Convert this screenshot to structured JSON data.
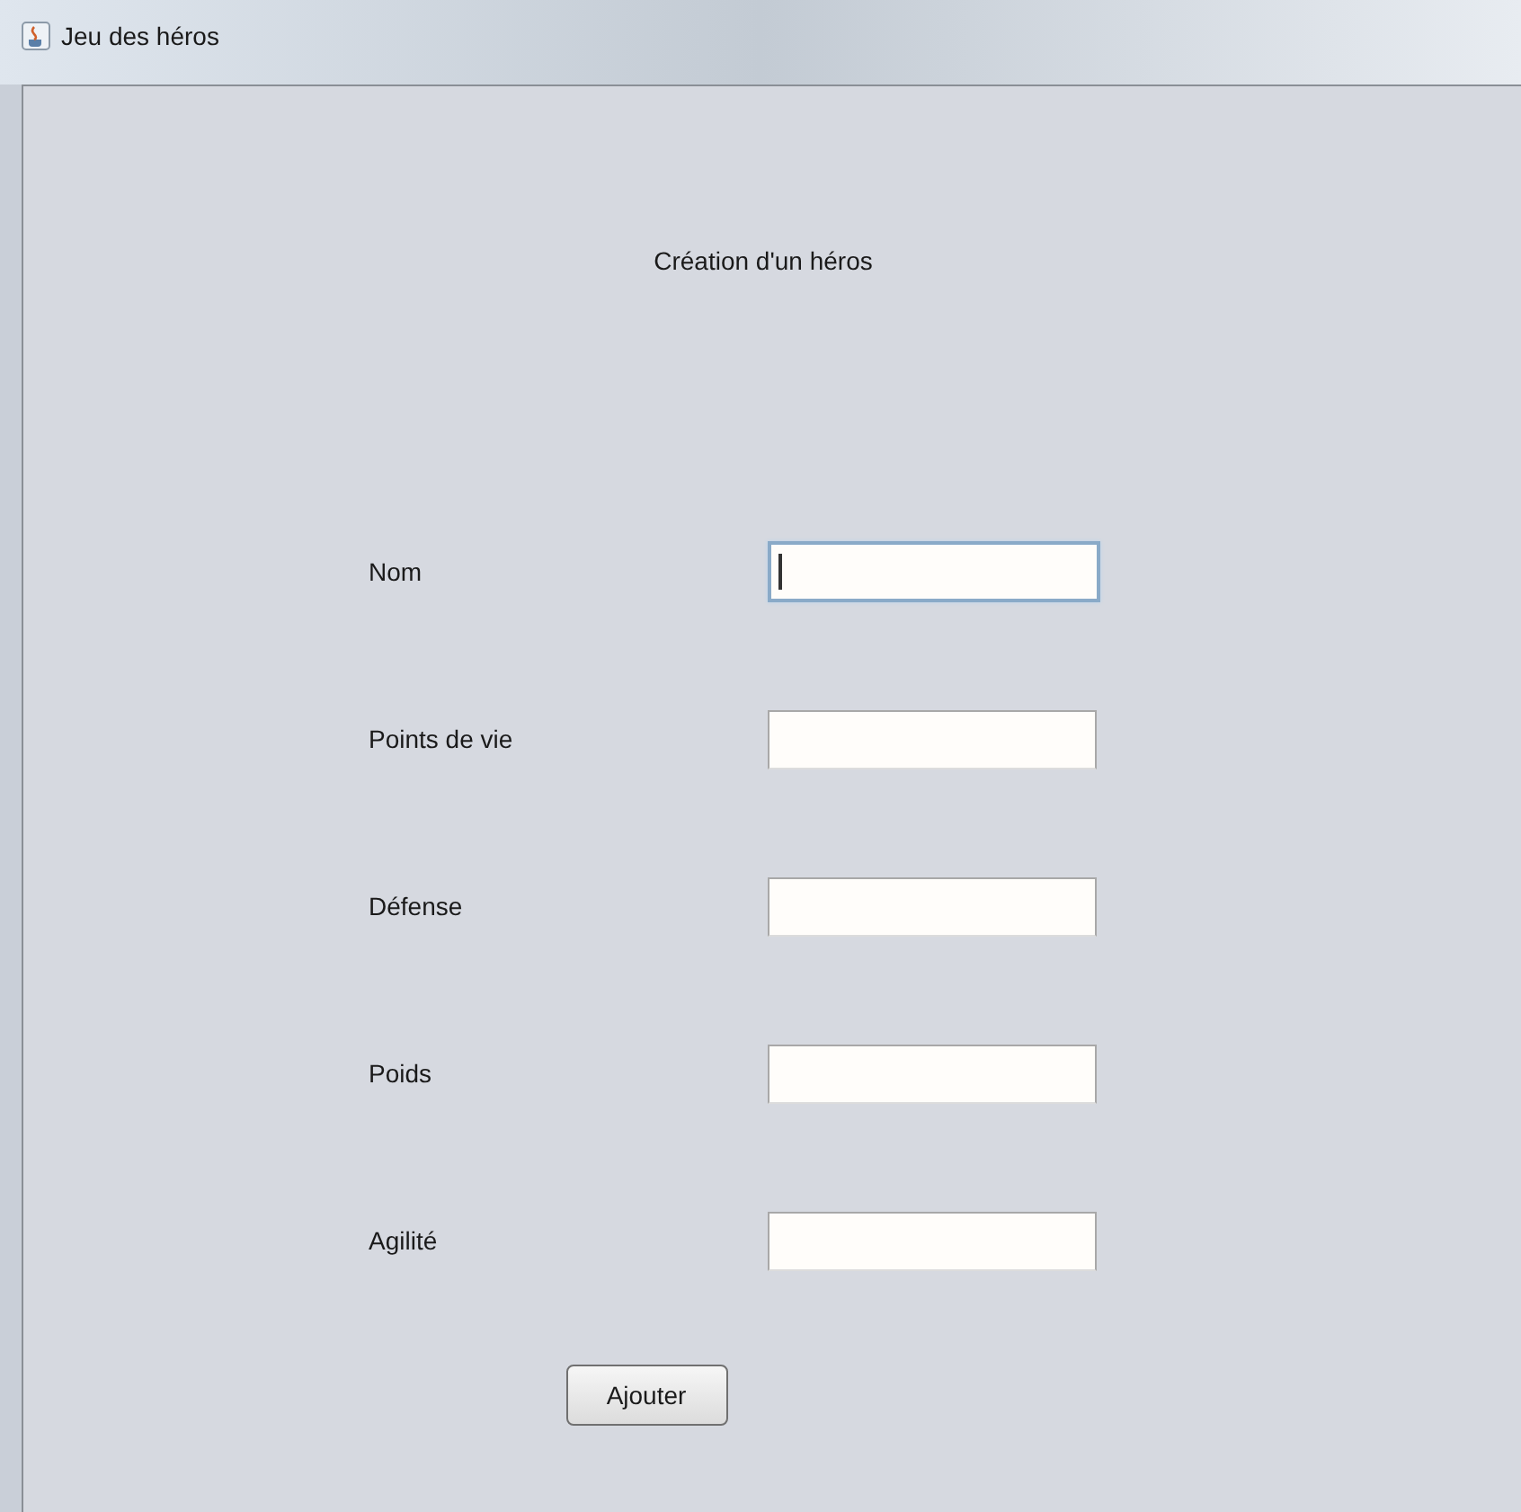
{
  "window": {
    "title": "Jeu des héros"
  },
  "heading": "Création d'un héros",
  "fields": [
    {
      "label": "Nom",
      "focused": true
    },
    {
      "label": "Points de vie",
      "focused": false
    },
    {
      "label": "Défense",
      "focused": false
    },
    {
      "label": "Poids",
      "focused": false
    },
    {
      "label": "Agilité",
      "focused": false
    }
  ],
  "button": "Ajouter"
}
